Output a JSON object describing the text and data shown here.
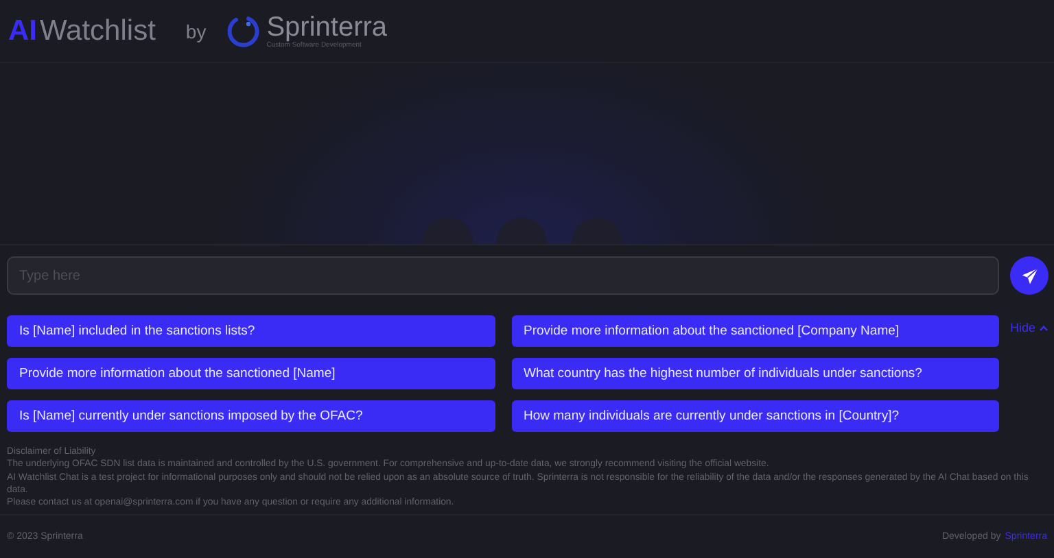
{
  "header": {
    "logo_accent": "AI",
    "logo_name": "Watchlist",
    "by": "by",
    "partner_name": "Sprinterra",
    "partner_tagline": "Custom Software Development"
  },
  "composer": {
    "placeholder": "Type here"
  },
  "suggestions": [
    {
      "text": "Is [Name] included in the sanctions lists?"
    },
    {
      "text": "Provide more information about the sanctioned [Company Name]"
    },
    {
      "text": "Provide more information about the sanctioned [Name]"
    },
    {
      "text": "What country has the highest number of individuals under sanctions?"
    },
    {
      "text": "Is [Name] currently under sanctions imposed by the OFAC?"
    },
    {
      "text": "How many individuals are currently under sanctions in [Country]?"
    }
  ],
  "hide_link": "Hide",
  "disclaimer": {
    "title": "Disclaimer of Liability",
    "paragraphs": [
      "The underlying OFAC SDN list data is maintained and controlled by the U.S. government. For comprehensive and up-to-date data, we strongly recommend visiting the official website.",
      "AI Watchlist Chat is a test project for informational purposes only and should not be relied upon as an absolute source of truth. Sprinterra is not responsible for the reliability of the data and/or the responses generated by the AI Chat based on this data.",
      "Please contact us at openai@sprinterra.com if you have any question or require any additional information."
    ]
  },
  "footer": {
    "copyright": "© 2023 Sprinterra",
    "developed_by": "Developed by",
    "developer": "Sprinterra"
  }
}
